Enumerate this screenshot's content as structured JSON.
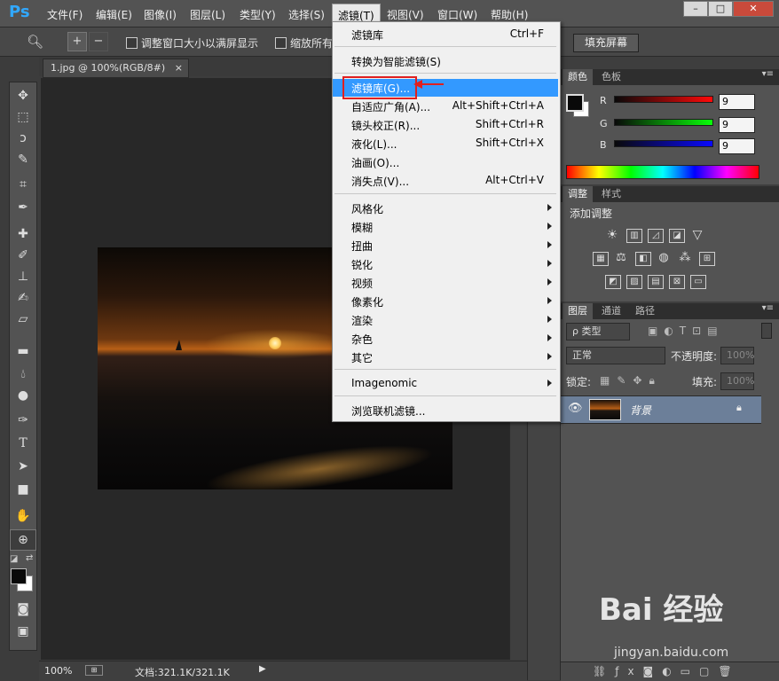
{
  "app": {
    "logo": "Ps"
  },
  "menubar": {
    "items": [
      "文件(F)",
      "编辑(E)",
      "图像(I)",
      "图层(L)",
      "类型(Y)",
      "选择(S)",
      "滤镜(T)",
      "视图(V)",
      "窗口(W)",
      "帮助(H)"
    ],
    "active_index": 6
  },
  "window_controls": {
    "min": "–",
    "max": "□",
    "close": "✕"
  },
  "options": {
    "chk1_label": "调整窗口大小以满屏显示",
    "chk2_label": "缩放所有",
    "fill_screen": "填充屏幕"
  },
  "document": {
    "tab_label": "1.jpg @ 100%(RGB/8#)",
    "tab_close": "×",
    "zoom": "100%",
    "doc_info": "文档:321.1K/321.1K"
  },
  "filter_menu": {
    "items": [
      {
        "label": "滤镜库",
        "shortcut": "Ctrl+F"
      },
      {
        "label": "转换为智能滤镜(S)",
        "shortcut": ""
      },
      {
        "label": "滤镜库(G)...",
        "shortcut": "",
        "highlighted": true
      },
      {
        "label": "自适应广角(A)...",
        "shortcut": "Alt+Shift+Ctrl+A"
      },
      {
        "label": "镜头校正(R)...",
        "shortcut": "Shift+Ctrl+R"
      },
      {
        "label": "液化(L)...",
        "shortcut": "Shift+Ctrl+X"
      },
      {
        "label": "油画(O)...",
        "shortcut": ""
      },
      {
        "label": "消失点(V)...",
        "shortcut": "Alt+Ctrl+V"
      },
      {
        "label": "风格化",
        "submenu": true
      },
      {
        "label": "模糊",
        "submenu": true
      },
      {
        "label": "扭曲",
        "submenu": true
      },
      {
        "label": "锐化",
        "submenu": true
      },
      {
        "label": "视频",
        "submenu": true
      },
      {
        "label": "像素化",
        "submenu": true
      },
      {
        "label": "渲染",
        "submenu": true
      },
      {
        "label": "杂色",
        "submenu": true
      },
      {
        "label": "其它",
        "submenu": true
      },
      {
        "label": "Imagenomic",
        "submenu": true
      },
      {
        "label": "浏览联机滤镜..."
      }
    ]
  },
  "color_panel": {
    "tabs": [
      "颜色",
      "色板"
    ],
    "r_label": "R",
    "g_label": "G",
    "b_label": "B",
    "r_value": "9",
    "g_value": "9",
    "b_value": "9"
  },
  "adjust_panel": {
    "tabs": [
      "调整",
      "样式"
    ],
    "title": "添加调整"
  },
  "layers_panel": {
    "tabs": [
      "图层",
      "通道",
      "路径"
    ],
    "filter_type": "ρ 类型",
    "blend_mode": "正常",
    "opacity_label": "不透明度:",
    "opacity_value": "100%",
    "lock_label": "锁定:",
    "fill_label": "填充:",
    "fill_value": "100%",
    "layer_name": "背景"
  },
  "watermark": {
    "brand": "Bai 经验",
    "url": "jingyan.baidu.com"
  },
  "colors": {
    "accent": "#31a8ff",
    "highlight": "#3399ff",
    "annotation": "#e02020"
  }
}
